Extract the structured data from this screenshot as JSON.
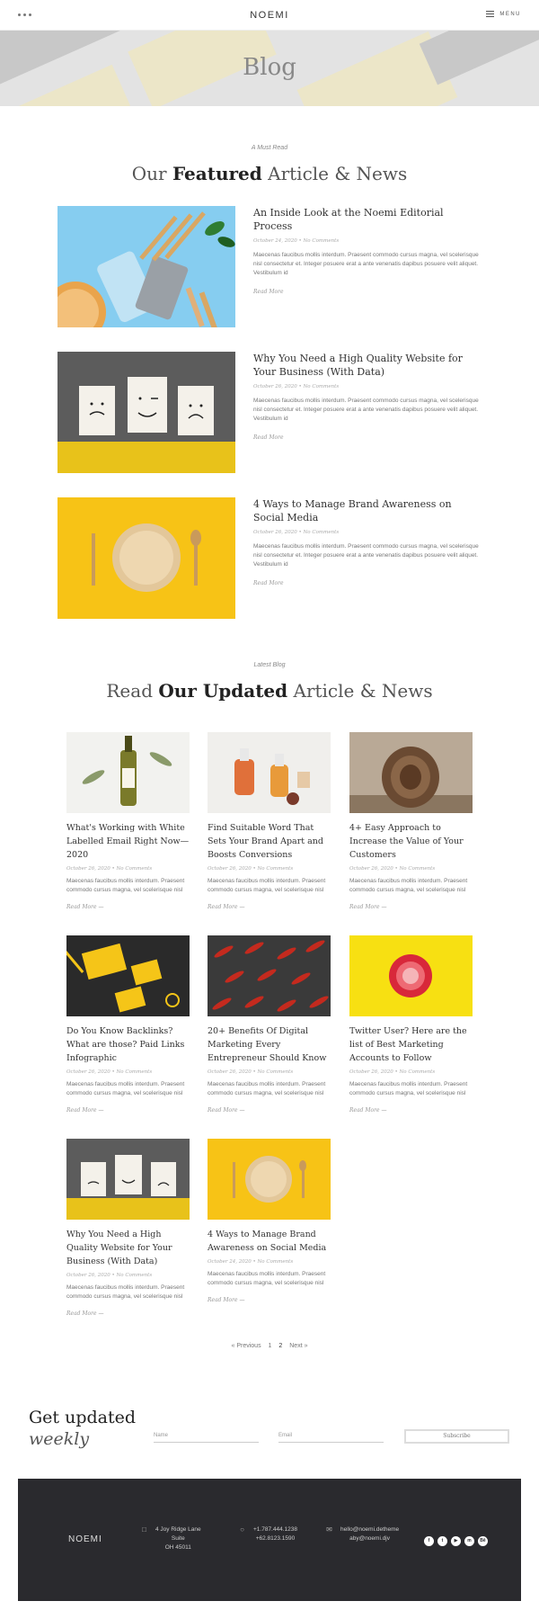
{
  "header": {
    "logo": "NOEMI",
    "menu_label": "MENU"
  },
  "hero": {
    "title": "Blog"
  },
  "featured_section": {
    "kicker": "A Must Read",
    "title_pre": "Our ",
    "title_bold": "Featured",
    "title_post": " Article & News",
    "posts": [
      {
        "title": "An Inside Look at the Noemi Editorial Process",
        "meta": "October 24, 2020 • No Comments",
        "excerpt": "Maecenas faucibus mollis interdum. Praesent commodo cursus magna, vel scelerisque nisl consectetur et. Integer posuere erat a ante venenatis dapibus posuere velit aliquet. Vestibulum id",
        "read_more": "Read More"
      },
      {
        "title": "Why You Need a High Quality Website for Your Business (With Data)",
        "meta": "October 26, 2020 • No Comments",
        "excerpt": "Maecenas faucibus mollis interdum. Praesent commodo cursus magna, vel scelerisque nisl consectetur et. Integer posuere erat a ante venenatis dapibus posuere velit aliquet. Vestibulum id",
        "read_more": "Read More"
      },
      {
        "title": "4 Ways to Manage Brand Awareness on Social Media",
        "meta": "October 26, 2020 • No Comments",
        "excerpt": "Maecenas faucibus mollis interdum. Praesent commodo cursus magna, vel scelerisque nisl consectetur et. Integer posuere erat a ante venenatis dapibus posuere velit aliquet. Vestibulum id",
        "read_more": "Read More"
      }
    ]
  },
  "latest_section": {
    "kicker": "Latest Blog",
    "title_pre": "Read ",
    "title_bold": "Our Updated",
    "title_post": " Article & News",
    "posts": [
      {
        "title": "What's Working with White Labelled Email Right Now—2020",
        "meta": "October 26, 2020 • No Comments",
        "excerpt": "Maecenas faucibus mollis interdum. Praesent commodo cursus magna, vel scelerisque nisl",
        "read_more": "Read More —"
      },
      {
        "title": "Find Suitable Word That Sets Your Brand Apart and Boosts Conversions",
        "meta": "October 26, 2020 • No Comments",
        "excerpt": "Maecenas faucibus mollis interdum. Praesent commodo cursus magna, vel scelerisque nisl",
        "read_more": "Read More —"
      },
      {
        "title": "4+ Easy Approach to Increase the Value of Your Customers",
        "meta": "October 26, 2020 • No Comments",
        "excerpt": "Maecenas faucibus mollis interdum. Praesent commodo cursus magna, vel scelerisque nisl",
        "read_more": "Read More —"
      },
      {
        "title": "Do You Know Backlinks? What are those? Paid Links Infographic",
        "meta": "October 26, 2020 • No Comments",
        "excerpt": "Maecenas faucibus mollis interdum. Praesent commodo cursus magna, vel scelerisque nisl",
        "read_more": "Read More —"
      },
      {
        "title": "20+ Benefits Of Digital Marketing Every Entrepreneur Should Know",
        "meta": "October 26, 2020 • No Comments",
        "excerpt": "Maecenas faucibus mollis interdum. Praesent commodo cursus magna, vel scelerisque nisl",
        "read_more": "Read More —"
      },
      {
        "title": "Twitter User? Here are the list of Best Marketing Accounts to Follow",
        "meta": "October 26, 2020 • No Comments",
        "excerpt": "Maecenas faucibus mollis interdum. Praesent commodo cursus magna, vel scelerisque nisl",
        "read_more": "Read More —"
      },
      {
        "title": "Why You Need a High Quality Website for Your Business (With Data)",
        "meta": "October 26, 2020 • No Comments",
        "excerpt": "Maecenas faucibus mollis interdum. Praesent commodo cursus magna, vel scelerisque nisl",
        "read_more": "Read More —"
      },
      {
        "title": "4 Ways to Manage Brand Awareness on Social Media",
        "meta": "October 24, 2020 • No Comments",
        "excerpt": "Maecenas faucibus mollis interdum. Praesent commodo cursus magna, vel scelerisque nisl",
        "read_more": "Read More —"
      }
    ]
  },
  "pagination": {
    "prev": "« Previous",
    "page1": "1",
    "page2": "2",
    "next": "Next »"
  },
  "subscribe": {
    "title_line1": "Get updated",
    "title_line2": "weekly",
    "name_placeholder": "Name",
    "email_placeholder": "Email",
    "button": "Subscribe"
  },
  "footer": {
    "logo": "NOEMI",
    "address_lines": [
      "4 Joy Ridge Lane",
      "Suite",
      "OH 45011"
    ],
    "phone_lines": [
      "+1.787.444.1238",
      "+62.8123.1590"
    ],
    "email_lines": [
      "hello@noemi.detheme",
      "aby@noemi.djv"
    ],
    "socials": [
      "facebook-icon",
      "twitter-icon",
      "youtube-icon",
      "messenger-icon",
      "behance-icon"
    ]
  },
  "colors": {
    "footer_bg": "#2a2a2e",
    "accent_yellow": "#f5c518"
  }
}
